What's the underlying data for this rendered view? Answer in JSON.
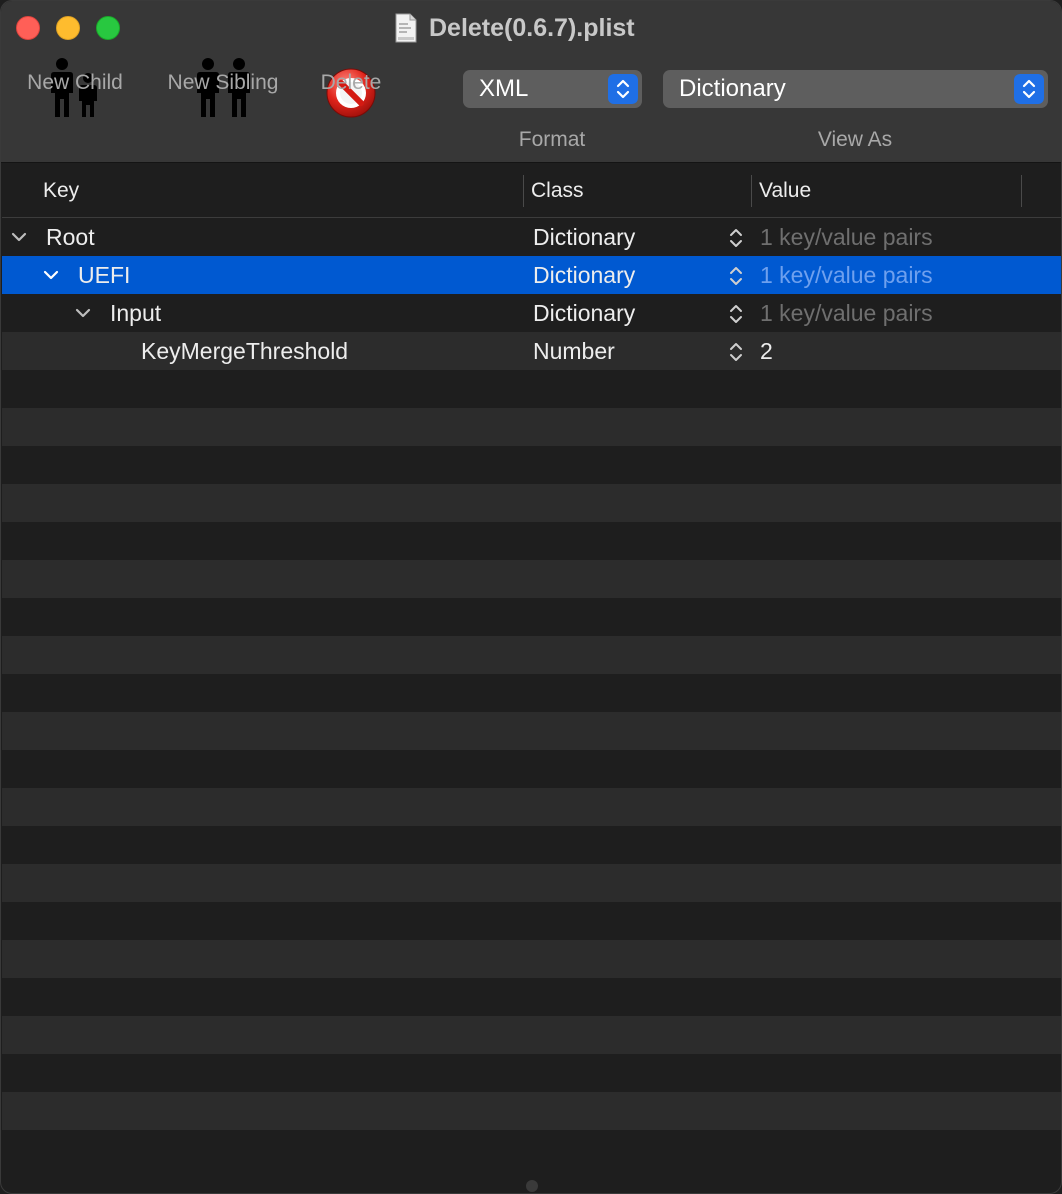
{
  "window": {
    "title": "Delete(0.6.7).plist",
    "file_icon": "plist-file-icon"
  },
  "toolbar": {
    "new_child": {
      "label": "New Child",
      "icon": "new-child-icon"
    },
    "new_sibling": {
      "label": "New Sibling",
      "icon": "new-sibling-icon"
    },
    "delete": {
      "label": "Delete",
      "icon": "delete-icon"
    },
    "format": {
      "label": "Format",
      "selected": "XML"
    },
    "view_as": {
      "label": "View As",
      "selected": "Dictionary"
    }
  },
  "table": {
    "columns": [
      "Key",
      "Class",
      "Value"
    ],
    "rows": [
      {
        "key": "Root",
        "class": "Dictionary",
        "value": "1 key/value pairs",
        "expanded": true,
        "placeholder": true
      },
      {
        "key": "UEFI",
        "class": "Dictionary",
        "value": "1 key/value pairs",
        "expanded": true,
        "placeholder": true,
        "selected": true
      },
      {
        "key": "Input",
        "class": "Dictionary",
        "value": "1 key/value pairs",
        "expanded": true,
        "placeholder": true
      },
      {
        "key": "KeyMergeThreshold",
        "class": "Number",
        "value": "2",
        "expanded": false,
        "placeholder": false
      }
    ]
  },
  "colors": {
    "selection": "#0059d1",
    "accent": "#1f6fe6"
  }
}
